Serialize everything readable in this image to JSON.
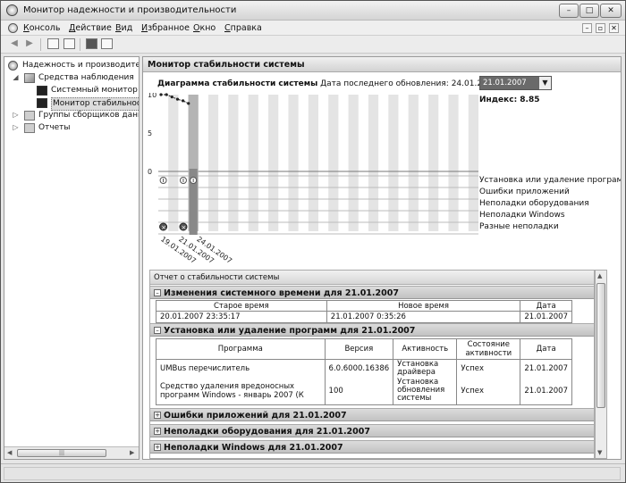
{
  "window": {
    "title": "Монитор надежности и производительности",
    "controls": {
      "minimize": "–",
      "maximize": "□",
      "close": "✕"
    }
  },
  "menu": [
    {
      "label": "Консоль",
      "underline": "К",
      "rest": "онсоль"
    },
    {
      "label": "Действие",
      "underline": "Д",
      "rest": "ействие"
    },
    {
      "label": "Вид",
      "underline": "В",
      "rest": "ид"
    },
    {
      "label": "Избранное",
      "underline": "И",
      "rest": "збранное"
    },
    {
      "label": "Окно",
      "underline": "О",
      "rest": "кно"
    },
    {
      "label": "Справка",
      "underline": "С",
      "rest": "правка"
    }
  ],
  "tree": [
    {
      "label": "Надежность и производительно",
      "icon": "gear-icon",
      "expander": ""
    },
    {
      "label": "Средства наблюдения",
      "icon": "tools-icon",
      "expander": "◢"
    },
    {
      "label": "Системный монитор",
      "icon": "monitor-icon",
      "expander": ""
    },
    {
      "label": "Монитор стабильности",
      "icon": "monitor-icon",
      "expander": ""
    },
    {
      "label": "Группы сборщиков данны",
      "icon": "folder-icon",
      "expander": "▷"
    },
    {
      "label": "Отчеты",
      "icon": "folder-icon",
      "expander": "▷"
    }
  ],
  "pane": {
    "header": "Монитор стабильности системы",
    "chart_title_bold": "Диаграмма стабильности системы",
    "chart_title_rest": " Дата последнего обновления: 24.01.2007",
    "selected_date": "21.01.2007",
    "index_text": "Индекс: 8.85"
  },
  "chart_data": {
    "type": "line",
    "title": "Диаграмма стабильности системы",
    "y_ticks": [
      "10",
      "5",
      "0"
    ],
    "ylim": [
      0,
      10
    ],
    "x_tick_labels": [
      "19.01.2007",
      "21.01.2007",
      "24.01.2007"
    ],
    "selected_column": "21.01.2007",
    "series": [
      {
        "values": [
          10,
          10,
          9.7,
          9.4,
          9.2,
          8.85
        ]
      }
    ],
    "categories": [
      "Установка или удаление программ",
      "Ошибки приложений",
      "Неполадки оборудования",
      "Неполадки Windows",
      "Разные неполадки"
    ]
  },
  "report": {
    "title": "Отчет о стабильности системы",
    "sections": [
      {
        "label": "Изменения системного времени для 21.01.2007",
        "toggle": "–",
        "columns": [
          "Старое время",
          "Новое время",
          "Дата"
        ],
        "rows": [
          [
            "20.01.2007 23:35:17",
            "21.01.2007 0:35:26",
            "21.01.2007"
          ]
        ]
      },
      {
        "label": "Установка или удаление программ для 21.01.2007",
        "toggle": "–",
        "columns": [
          "Программа",
          "Версия",
          "Активность",
          "Состояние активности",
          "Дата"
        ],
        "rows": [
          [
            "UMBus перечислитель",
            "6.0.6000.16386",
            "Установка драйвера",
            "Успех",
            "21.01.2007"
          ],
          [
            "Средство удаления вредоносных программ Windows - январь 2007 (К",
            "100",
            "Установка обновления системы",
            "Успех",
            "21.01.2007"
          ]
        ]
      },
      {
        "label": "Ошибки приложений для 21.01.2007",
        "toggle": "+"
      },
      {
        "label": "Неполадки оборудования для 21.01.2007",
        "toggle": "+"
      },
      {
        "label": "Неполадки Windows для 21.01.2007",
        "toggle": "+"
      }
    ]
  }
}
